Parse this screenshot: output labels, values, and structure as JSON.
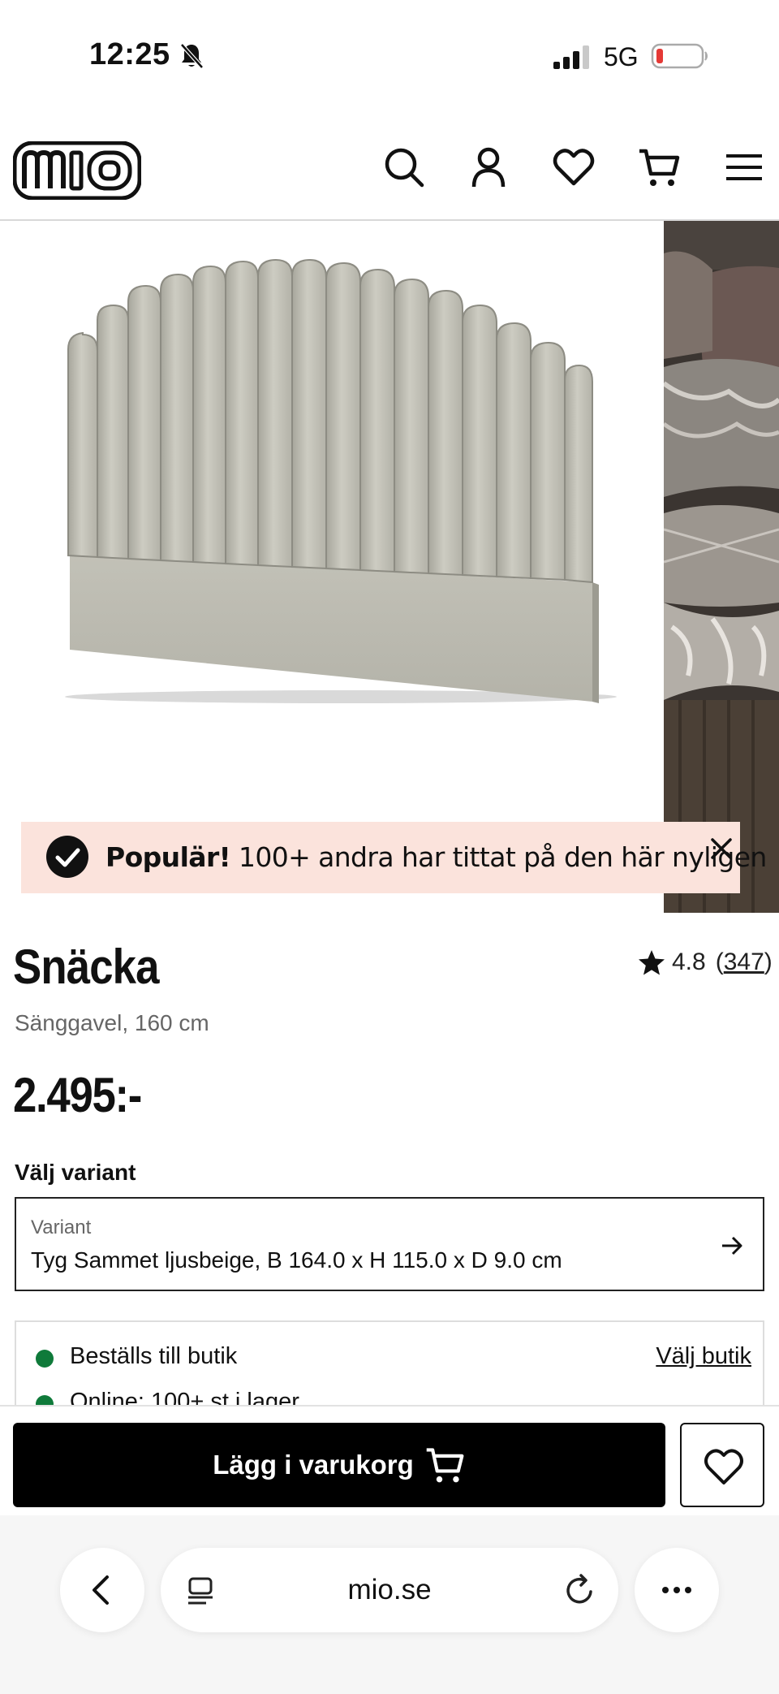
{
  "status_bar": {
    "time": "12:25",
    "network": "5G",
    "icons": [
      "bell-slash-icon",
      "signal-icon",
      "battery-low-icon"
    ],
    "battery_color": "#e53935"
  },
  "header": {
    "logo": "mio",
    "icons": [
      "search-icon",
      "account-icon",
      "heart-icon",
      "cart-icon",
      "hamburger-menu-icon"
    ]
  },
  "gallery": {
    "main_image": "upholstered-headboard-image",
    "side_image": "bedroom-lifestyle-image",
    "banner": {
      "bold": "Populär!",
      "text": " 100+ andra har tittat på den här nyligen",
      "background": "#fbe3dc"
    }
  },
  "product": {
    "title": "Snäcka",
    "rating_value": "4.8",
    "rating_open": "(",
    "rating_count": "347",
    "rating_close": ")",
    "subtitle": "Sänggavel, 160 cm",
    "price": "2.495:-"
  },
  "variant": {
    "heading": "Välj variant",
    "label": "Variant",
    "value": "Tyg Sammet ljusbeige, B 164.0 x H 115.0 x D 9.0 cm"
  },
  "stock": {
    "store_text": "Beställs till butik",
    "choose_store": "Välj butik",
    "online_text": "Online: 100+ st i lager",
    "dot_color": "#0f7a3a"
  },
  "actions": {
    "add_to_cart": "Lägg i varukorg"
  },
  "browser": {
    "url": "mio.se"
  }
}
